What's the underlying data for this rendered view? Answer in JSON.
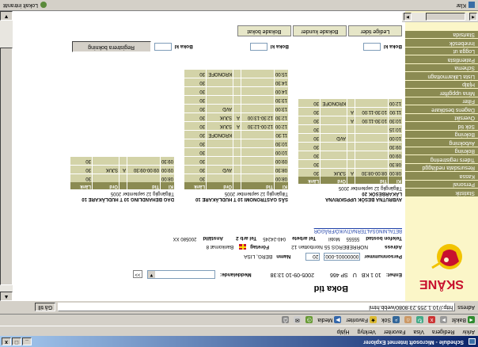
{
  "window": {
    "title": "Schedule - Microsoft Internet Explorer",
    "min": "_",
    "max": "□",
    "close": "x"
  },
  "menu": [
    "Arkiv",
    "Redigera",
    "Visa",
    "Favoriter",
    "Verktyg",
    "Hjälp"
  ],
  "toolbar": {
    "back": "Bakåt",
    "search": "Sök",
    "favorites": "Favoriter",
    "media": "Media"
  },
  "address": {
    "label": "Adress",
    "url": "http://10.1.255.23:8080/webb.html",
    "go": "Gå till"
  },
  "status": {
    "left": "Klar",
    "right": "Lokalt intranät"
  },
  "page": {
    "heading": "Boka tid",
    "enhet_label": "Enhet:",
    "enhet": "10 1 KB",
    "u": "U",
    "sp": "SP 466",
    "datetime": "2005-09-10 13:38",
    "meddelande_label": "Meddelande:",
    "meddelande_btn": ">>",
    "personnummer_label": "Personnummer",
    "personnummer": "00000001-0001",
    "pnr_suffix": "20",
    "namn_label": "Namn",
    "namn": "BERG, LISA",
    "adress_label": "Adress",
    "adress": "NORREBERGS 55 Norrbotten 12",
    "foretag_label": "Företag",
    "foretag": "Bankomat 8",
    "tel_label": "Telefon bostad",
    "tel_bostad": "55555",
    "tel_mobil_label": "Mobil",
    "tel_mobil": "",
    "tel_arbete_label": "Tel arbete",
    "tel_arbete": "040-24245",
    "tel_arbete2_label": "Tel arb 2",
    "tel_arbete2": "",
    "anstalld_label": "Anställd",
    "anstalld": "200580 XX",
    "link": "BETALNINGSALTERNATIV/KÖ/FRÅGOR",
    "boka_label": "Boka kl",
    "boka_val_1": "",
    "boka_val_2": "",
    "boka_val_3": "",
    "register_btn": "Registrera bokning",
    "tabs": [
      "Ledige tider",
      "Bokade kunder",
      "Bokade bokat"
    ]
  },
  "nav": [
    "Startsida",
    "Innebesök",
    "Logga ut",
    "Patientlista",
    "Schema",
    "Lista Läkarmottagn",
    "Hjälp",
    "Mina uppgifter",
    "Filter",
    "Dagens besökare",
    "Oversikt",
    "Sök tid",
    "Bokning",
    "Avbokning",
    "Bokning",
    "Tiders registrering",
    "Resursdata nedläggd",
    "Kassa",
    "Personal",
    "Statistik"
  ],
  "boards": [
    {
      "title": "AVBRUTNA BESÖK UPPSKRIVNA LÄKARBESÖK 20",
      "sub": "Tillgänglig 12 september 2005",
      "headers": [
        "Kl",
        "Tid",
        "",
        "Ord",
        "Länk"
      ],
      "rows": [
        [
          "08:00",
          "08:00-08:30",
          "A",
          "SJUK",
          "30"
        ],
        [
          "08:30",
          "",
          "",
          "",
          "30"
        ],
        [
          "09:00",
          "",
          "",
          "",
          "30"
        ],
        [
          "09:30",
          "",
          "",
          "",
          "30"
        ],
        [
          "10:00",
          "",
          "",
          "AVD",
          "30"
        ],
        [
          "10:15",
          "",
          "",
          "",
          "30"
        ],
        [
          "10:30",
          "10:30-11:00",
          "A",
          "",
          "30"
        ],
        [
          "11:00",
          "10:30-11:00",
          "A",
          "",
          "30"
        ],
        [
          "12:00",
          "",
          "",
          "KRONOFE",
          "30"
        ]
      ]
    },
    {
      "title": "SÅS GASTRONOMI 10 T HUDLÄKARE 10",
      "sub": "Tillgänglig 12 september 2005",
      "headers": [
        "Kl",
        "Tid",
        "",
        "Ord",
        "Länk"
      ],
      "rows": [
        [
          "08:00",
          "",
          "",
          "",
          "30"
        ],
        [
          "08:30",
          "",
          "",
          "AVD",
          "30"
        ],
        [
          "09:00",
          "",
          "",
          "",
          "30"
        ],
        [
          "10:00",
          "",
          "",
          "",
          "30"
        ],
        [
          "10:30",
          "",
          "",
          "",
          "30"
        ],
        [
          "11:30",
          "",
          "",
          "KRONOFE",
          "30"
        ],
        [
          "12:00",
          "12:00-12:30",
          "A",
          "SJUK",
          "30"
        ],
        [
          "12:30",
          "12:30-13:00",
          "A",
          "SJUK",
          "30"
        ],
        [
          "13:00",
          "",
          "",
          "AVD",
          "30"
        ],
        [
          "13:30",
          "",
          "",
          "",
          "30"
        ],
        [
          "14:00",
          "",
          "",
          "",
          "30"
        ],
        [
          "14:30",
          "",
          "",
          "",
          "30"
        ],
        [
          "15:00",
          "",
          "",
          "KRONOFE",
          "30"
        ]
      ]
    },
    {
      "title": "DAG BEHANDLING 10 T HUDLÄKARE 10",
      "sub": "Tillgänglig 12 september 2005",
      "headers": [
        "Kl",
        "Tid",
        "",
        "Ord",
        "Länk"
      ],
      "rows": [
        [
          "08:00",
          "",
          "",
          "",
          "30"
        ],
        [
          "09:00",
          "09:00-09:30",
          "A",
          "SJUK",
          "30"
        ],
        [
          "09:30",
          "",
          "",
          "",
          "30"
        ]
      ]
    }
  ]
}
